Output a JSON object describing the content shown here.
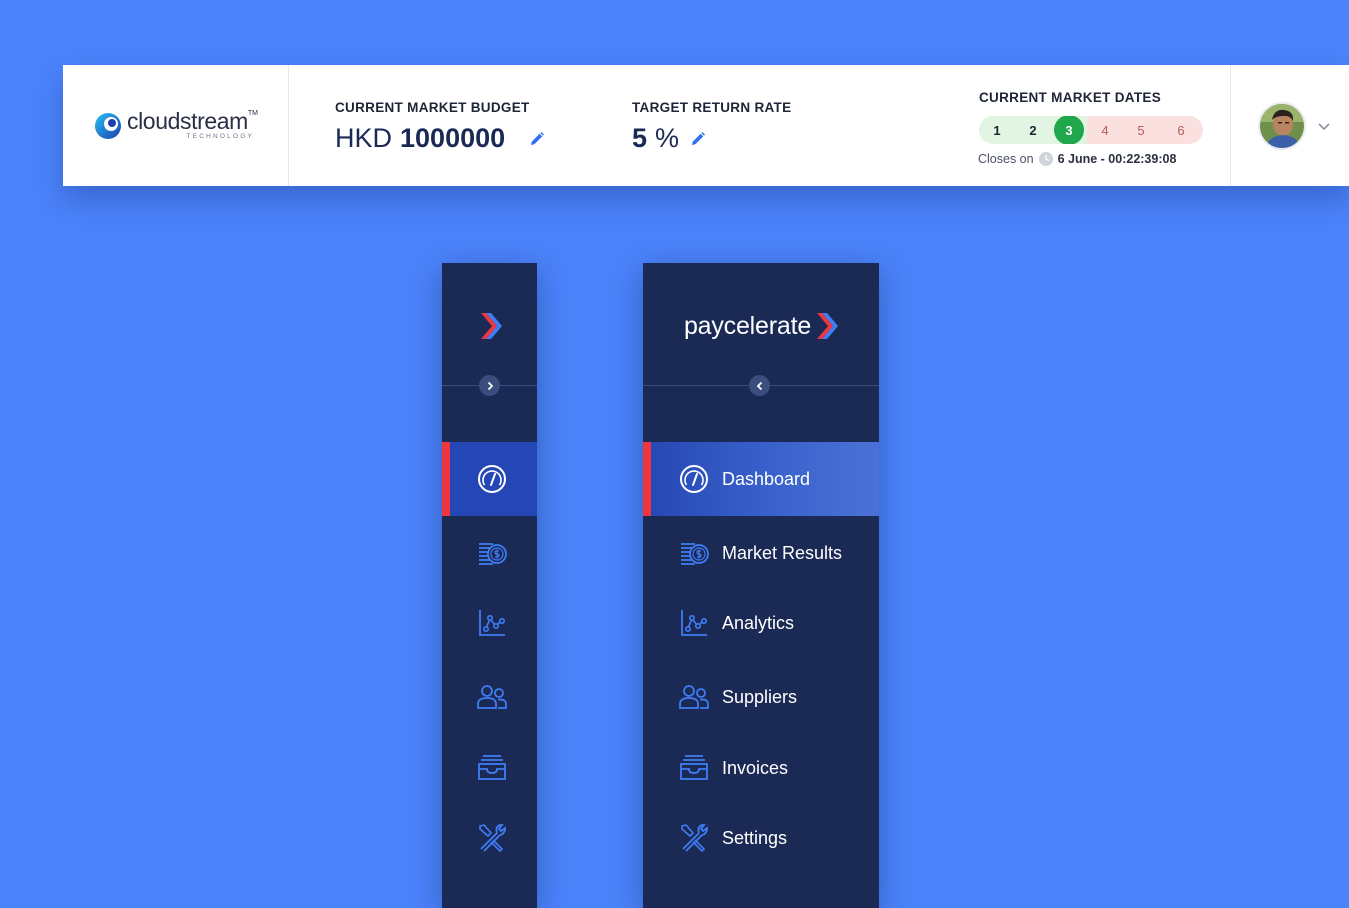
{
  "header": {
    "logo": {
      "name": "cloudstream",
      "tm": "TM",
      "sub": "TECHNOLOGY"
    },
    "budget": {
      "label": "CURRENT MARKET BUDGET",
      "currency": "HKD",
      "amount": "1000000"
    },
    "return_rate": {
      "label": "TARGET RETURN RATE",
      "value": "5",
      "unit": "%"
    },
    "market_dates": {
      "label": "CURRENT MARKET DATES",
      "dates": [
        "1",
        "2",
        "3",
        "4",
        "5",
        "6"
      ],
      "current_index": 2,
      "closes_prefix": "Closes on",
      "closes_time": "6 June - 00:22:39:08"
    }
  },
  "brand": {
    "name": "paycelerate"
  },
  "nav": {
    "items": [
      {
        "label": "Dashboard",
        "icon": "dashboard-gauge-icon"
      },
      {
        "label": "Market Results",
        "icon": "coin-stack-icon"
      },
      {
        "label": "Analytics",
        "icon": "analytics-chart-icon"
      },
      {
        "label": "Suppliers",
        "icon": "users-icon"
      },
      {
        "label": "Invoices",
        "icon": "inbox-tray-icon"
      },
      {
        "label": "Settings",
        "icon": "tools-icon"
      }
    ],
    "active_index": 0
  },
  "colors": {
    "background": "#4b83fb",
    "sidebar": "#1b2a54",
    "active_item": "#2447b5",
    "active_indicator": "#f0363c",
    "icon_blue": "#3f7df5",
    "current_date": "#20a64b",
    "past_date_bg": "#e2f5e2",
    "future_date_bg": "#fbe0e0"
  }
}
